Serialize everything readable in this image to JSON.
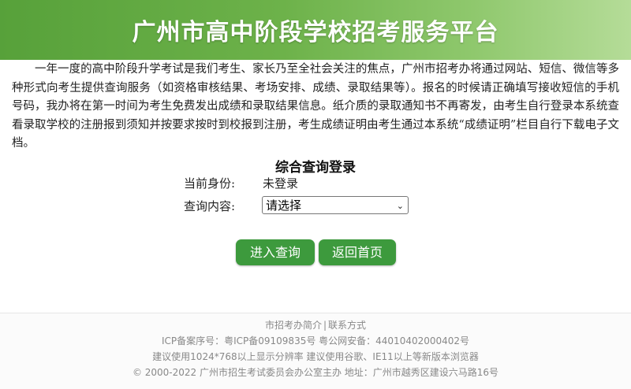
{
  "header": {
    "title": "广州市高中阶段学校招考服务平台",
    "bg_color": "#6db24a"
  },
  "intro": "一年一度的高中阶段升学考试是我们考生、家长乃至全社会关注的焦点，广州市招考办将通过网站、短信、微信等多种形式向考生提供查询服务（如资格审核结果、考场安排、成绩、录取结果等）。报名的时候请正确填写接收短信的手机号码，我办将在第一时间为考生免费发出成绩和录取结果信息。纸介质的录取通知书不再寄发，由考生自行登录本系统查看录取学校的注册报到须知并按要求按时到校报到注册，考生成绩证明由考生通过本系统“成绩证明”栏目自行下载电子文档。",
  "login": {
    "title": "综合查询登录",
    "identity_label": "当前身份:",
    "identity_value": "未登录",
    "content_label": "查询内容:",
    "select_value": "请选择",
    "submit_label": "进入查询",
    "home_label": "返回首页",
    "button_color": "#3d9a3d"
  },
  "footer": {
    "about_link": "市招考办简介",
    "separator": "|",
    "contact_link": "联系方式",
    "icp": "ICP备案序号：粤ICP备09109835号 粤公网安备：44010402000402号",
    "browser_tip": "建议使用1024*768以上显示分辨率 建议使用谷歌、IE11以上等新版本浏览器",
    "copyright": "© 2000-2022 广州市招生考试委员会办公室主办 地址：广州市越秀区建设六马路16号"
  }
}
